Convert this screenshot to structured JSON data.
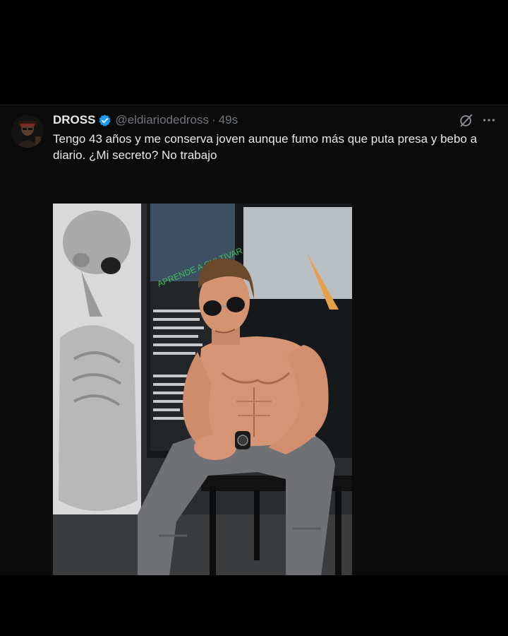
{
  "tweet": {
    "author": {
      "display_name": "DROSS",
      "handle": "@eldiariodedross",
      "verified": true
    },
    "separator": "·",
    "time": "49s",
    "text": "Tengo 43 años y me conserva joven aunque fumo más que puta presa y bebo a diario. ¿Mi secreto? No trabajo",
    "icons": {
      "grok": "grok-icon",
      "more": "more-icon",
      "verified": "verified-badge-icon"
    }
  },
  "colors": {
    "background": "#000000",
    "tweet_background": "#0b0b0c",
    "text_primary": "#e7e9ea",
    "text_secondary": "#71767b",
    "verified_blue": "#1d9bf0"
  }
}
